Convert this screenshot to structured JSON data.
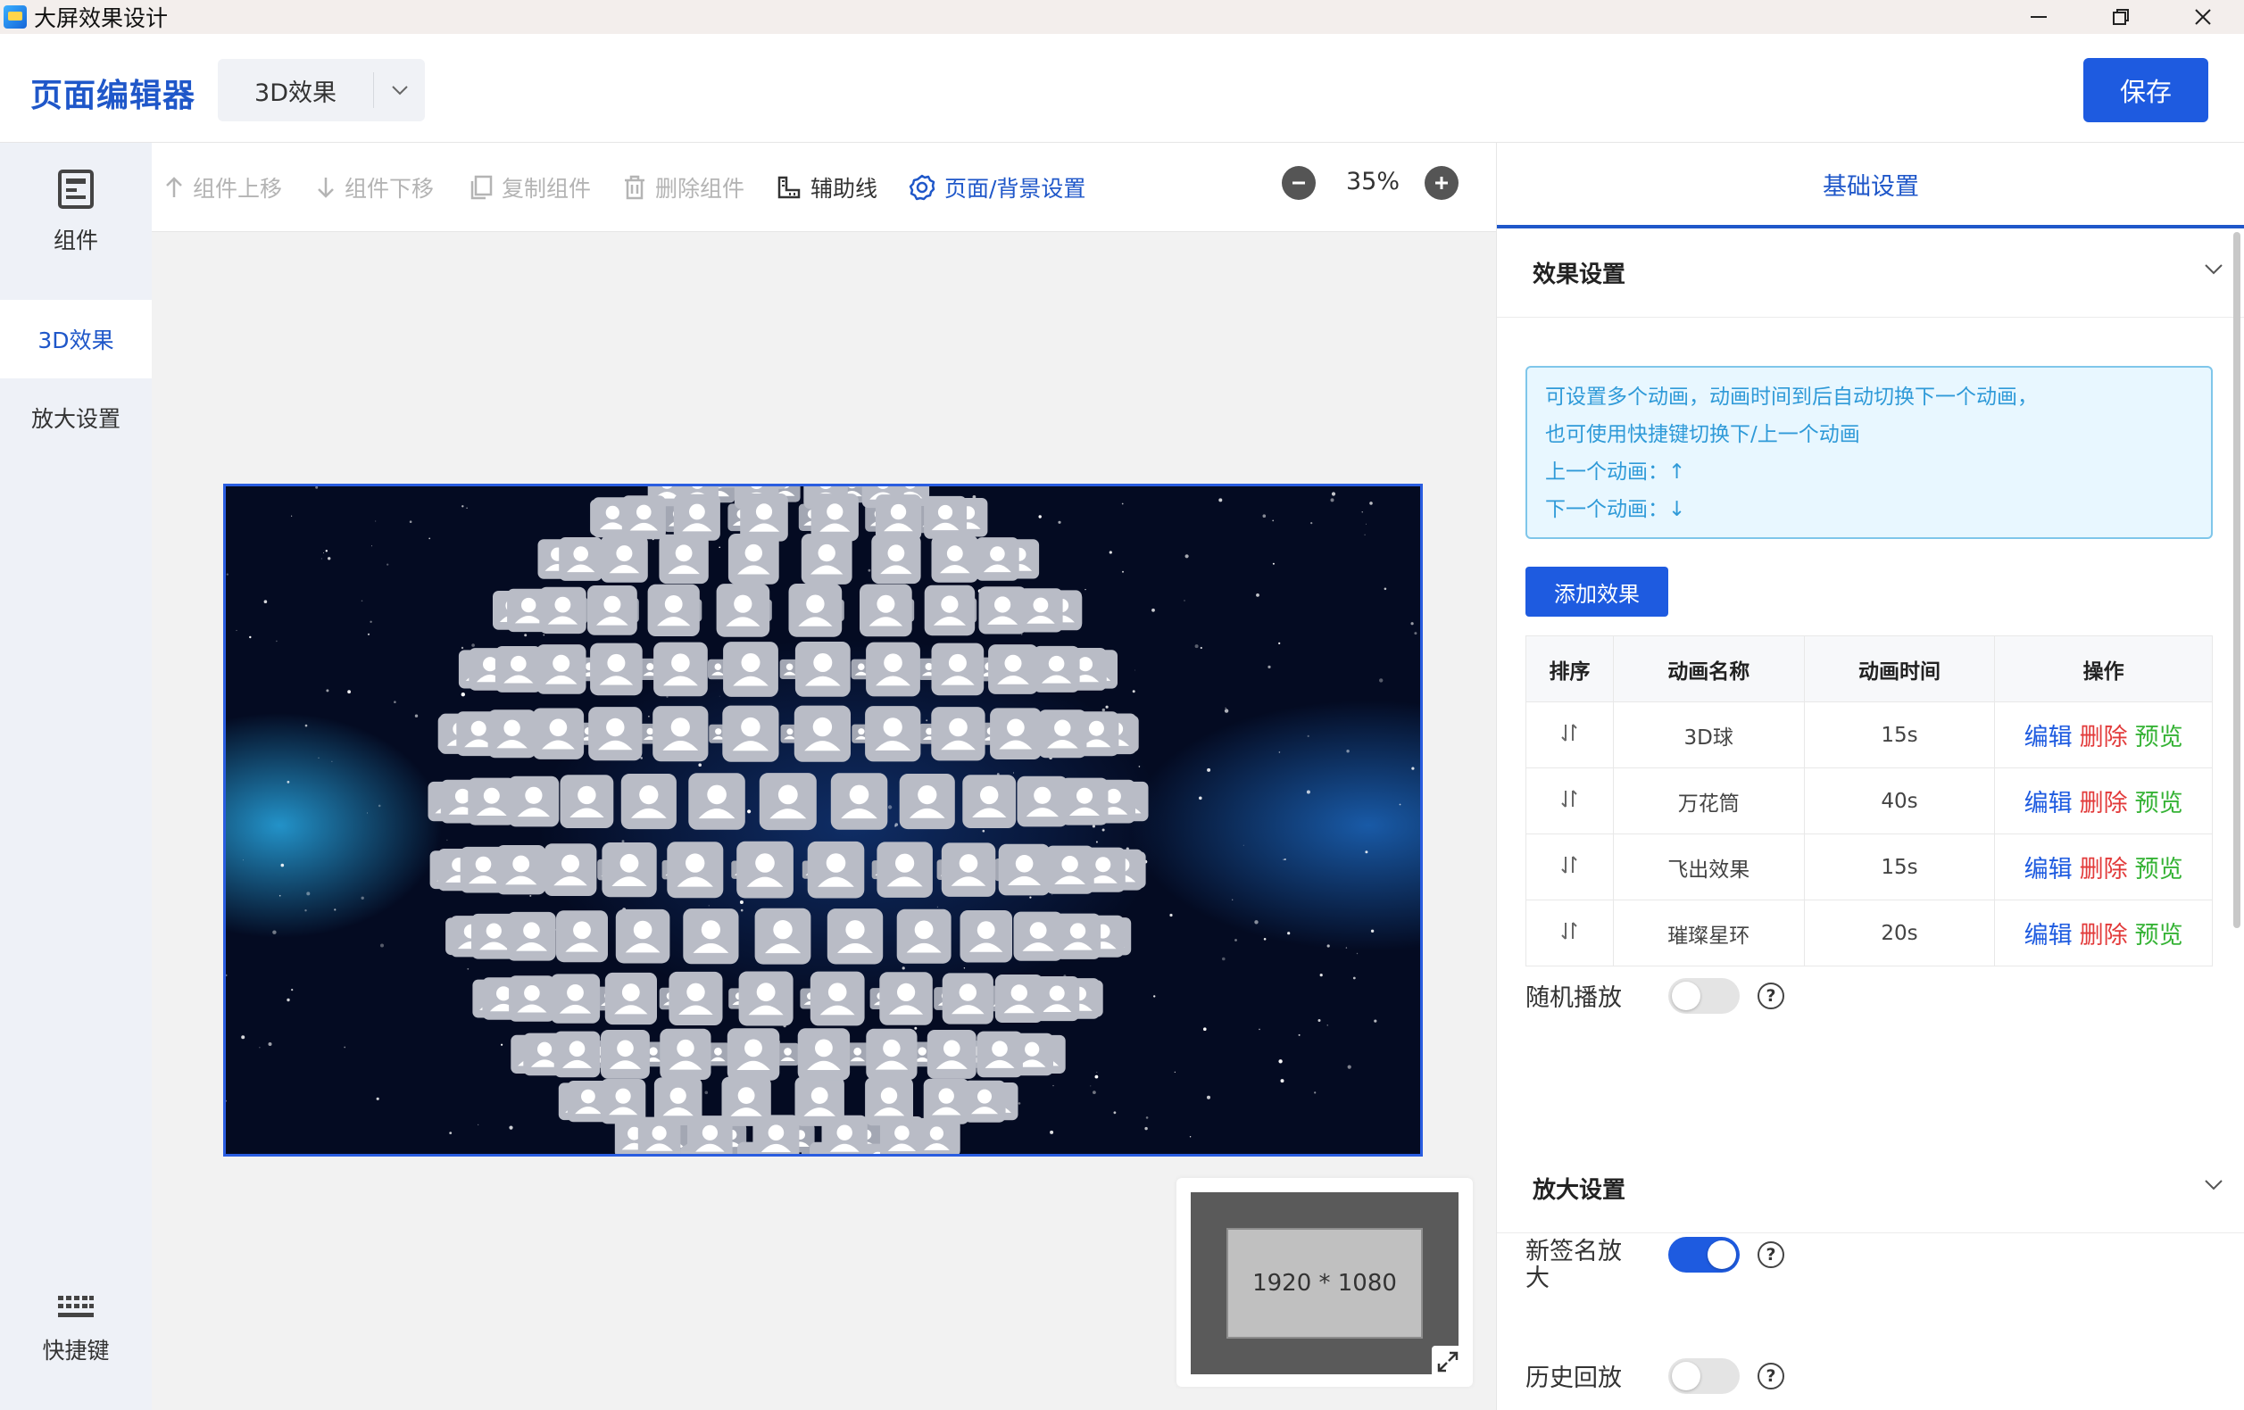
{
  "window": {
    "title": "大屏效果设计"
  },
  "header": {
    "brand": "页面编辑器",
    "effect_select": "3D效果",
    "save_label": "保存"
  },
  "sidebar": {
    "components_label": "组件",
    "items": [
      {
        "label": "3D效果",
        "active": true
      },
      {
        "label": "放大设置",
        "active": false
      }
    ],
    "shortcuts_label": "快捷键"
  },
  "toolbar": {
    "move_up": "组件上移",
    "move_down": "组件下移",
    "copy": "复制组件",
    "delete": "删除组件",
    "guides": "辅助线",
    "page_bg": "页面/背景设置",
    "zoom": "35%"
  },
  "canvas": {
    "minimap_label": "1920 * 1080"
  },
  "panel": {
    "tab": "基础设置",
    "effect_section": "效果设置",
    "tips": [
      "可设置多个动画，动画时间到后自动切换下一个动画，",
      "也可使用快捷键切换下/上一个动画",
      "上一个动画：↑",
      "下一个动画：↓"
    ],
    "add_effect": "添加效果",
    "table": {
      "headers": [
        "排序",
        "动画名称",
        "动画时间",
        "操作"
      ],
      "rows": [
        {
          "name": "3D球",
          "time": "15s"
        },
        {
          "name": "万花筒",
          "time": "40s"
        },
        {
          "name": "飞出效果",
          "time": "15s"
        },
        {
          "name": "璀璨星环",
          "time": "20s"
        }
      ],
      "actions": {
        "edit": "编辑",
        "delete": "删除",
        "preview": "预览"
      }
    },
    "random_play": {
      "label": "随机播放",
      "on": false
    },
    "zoom_section": "放大设置",
    "new_sign_zoom": {
      "label": "新签名放大",
      "on": true
    },
    "history_replay": {
      "label": "历史回放",
      "on": false
    }
  },
  "colors": {
    "accent": "#1e5be0",
    "delete": "#e23b3b",
    "preview": "#36b336",
    "tip_text": "#2f9ad8"
  }
}
